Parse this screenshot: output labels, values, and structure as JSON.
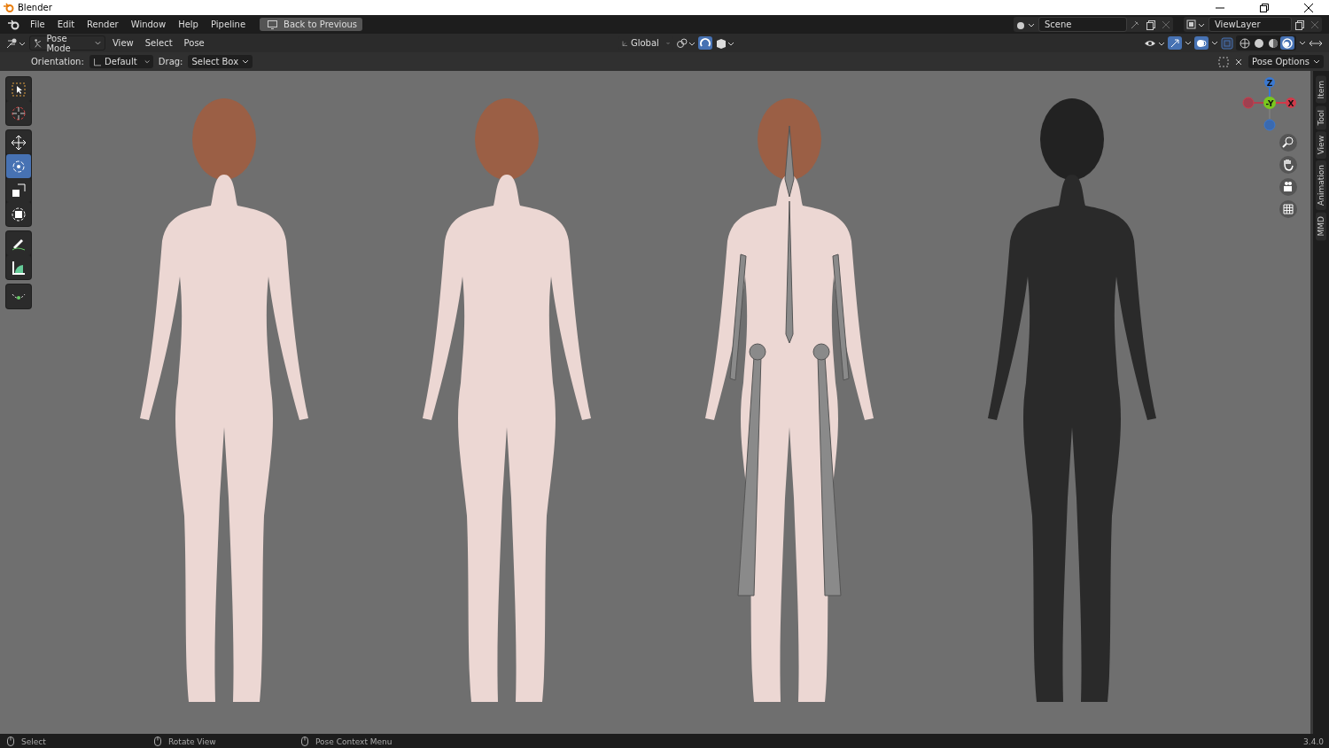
{
  "window": {
    "title": "Blender"
  },
  "menu": [
    "File",
    "Edit",
    "Render",
    "Window",
    "Help",
    "Pipeline"
  ],
  "back_button": "Back to Previous",
  "scene": "Scene",
  "view_layer": "ViewLayer",
  "header": {
    "mode": "Pose Mode",
    "menus": [
      "View",
      "Select",
      "Pose"
    ],
    "transform_orientation": "Global",
    "snap_on": true,
    "shading": [
      {
        "kind": "wireframe",
        "selected": false
      },
      {
        "kind": "solid",
        "selected": false
      },
      {
        "kind": "material",
        "selected": false
      },
      {
        "kind": "rendered",
        "selected": true
      }
    ]
  },
  "tool_settings": {
    "orientation_label": "Orientation:",
    "orientation": "Default",
    "drag_label": "Drag:",
    "drag": "Select Box",
    "options": "Pose Options"
  },
  "tools": [
    {
      "kind": "select",
      "selected": false
    },
    {
      "kind": "cursor",
      "selected": false
    },
    {
      "kind": "move",
      "selected": false
    },
    {
      "kind": "rotate",
      "selected": true
    },
    {
      "kind": "scale",
      "selected": false
    },
    {
      "kind": "transform",
      "selected": false
    },
    {
      "kind": "annotate",
      "selected": false
    },
    {
      "kind": "measure",
      "selected": false
    },
    {
      "kind": "bone",
      "selected": false
    }
  ],
  "gizmo": {
    "z": "Z",
    "y": "-Y",
    "x": "X"
  },
  "figures": [
    {
      "kind": "shaded"
    },
    {
      "kind": "shaded"
    },
    {
      "kind": "armature"
    },
    {
      "kind": "wireframe"
    }
  ],
  "sidebar_tabs": [
    "Item",
    "Tool",
    "View",
    "Animation",
    "MMD"
  ],
  "status_bar": {
    "items": [
      "Select",
      "Rotate View",
      "Pose Context Menu"
    ],
    "version": "3.4.0"
  }
}
